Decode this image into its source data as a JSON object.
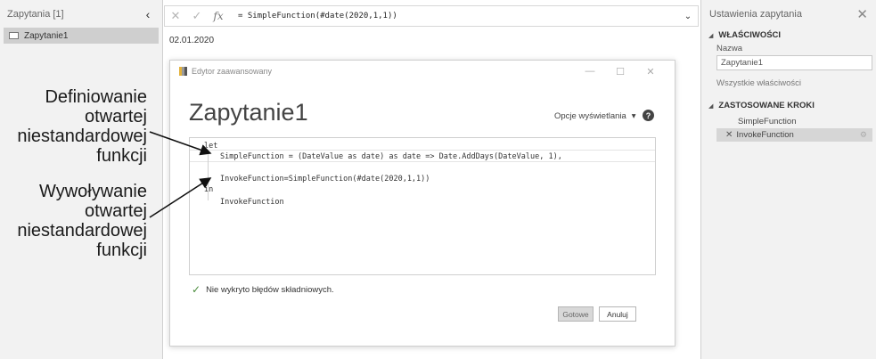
{
  "left_pane": {
    "title": "Zapytania [1]",
    "collapse_glyph": "‹",
    "queries": [
      {
        "label": "Zapytanie1",
        "icon": "table-icon"
      }
    ]
  },
  "formula_bar": {
    "cancel_glyph": "✕",
    "commit_glyph": "✓",
    "fx_label": "fx",
    "formula": "= SimpleFunction(#date(2020,1,1))",
    "expand_glyph": "⌄"
  },
  "preview_value": "02.01.2020",
  "annotations": {
    "definition": "Definiowanie otwartej niestandardowej funkcji",
    "invocation": "Wywoływanie otwartej niestandardowej funkcji"
  },
  "dialog": {
    "window_title": "Edytor zaawansowany",
    "minimize_glyph": "—",
    "maximize_glyph": "☐",
    "close_glyph": "✕",
    "heading": "Zapytanie1",
    "display_options": "Opcje wyświetlania",
    "display_options_glyph": "▾",
    "help_glyph": "?",
    "code": {
      "let": "let",
      "line1": "SimpleFunction = (DateValue as date) as date => Date.AddDays(DateValue, 1),",
      "line2": "InvokeFunction=SimpleFunction(#date(2020,1,1))",
      "in": "in",
      "line3": "InvokeFunction"
    },
    "status": "Nie wykryto błędów składniowych.",
    "done_button": "Gotowe",
    "cancel_button": "Anuluj"
  },
  "settings_pane": {
    "title": "Ustawienia zapytania",
    "close_glyph": "✕",
    "properties_header": "WŁAŚCIWOŚCI",
    "name_label": "Nazwa",
    "name_value": "Zapytanie1",
    "all_properties_link": "Wszystkie właściwości",
    "steps_header": "ZASTOSOWANE KROKI",
    "steps": [
      "SimpleFunction",
      "InvokeFunction"
    ],
    "selected_step": "InvokeFunction"
  }
}
